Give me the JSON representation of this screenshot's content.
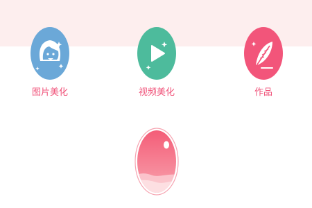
{
  "features": [
    {
      "label": "图片美化",
      "icon": "face-sparkle-icon",
      "color": "#6ba8d8"
    },
    {
      "label": "视频美化",
      "icon": "play-icon",
      "color": "#4dbb9c"
    },
    {
      "label": "作品",
      "icon": "feather-quill-icon",
      "color": "#f2557a"
    }
  ],
  "capture": {
    "icon": "capture-button-icon",
    "color": "#f27c8e"
  },
  "colors": {
    "header_band": "#fdeeee",
    "label_text": "#f0537a",
    "background": "#ffffff"
  }
}
